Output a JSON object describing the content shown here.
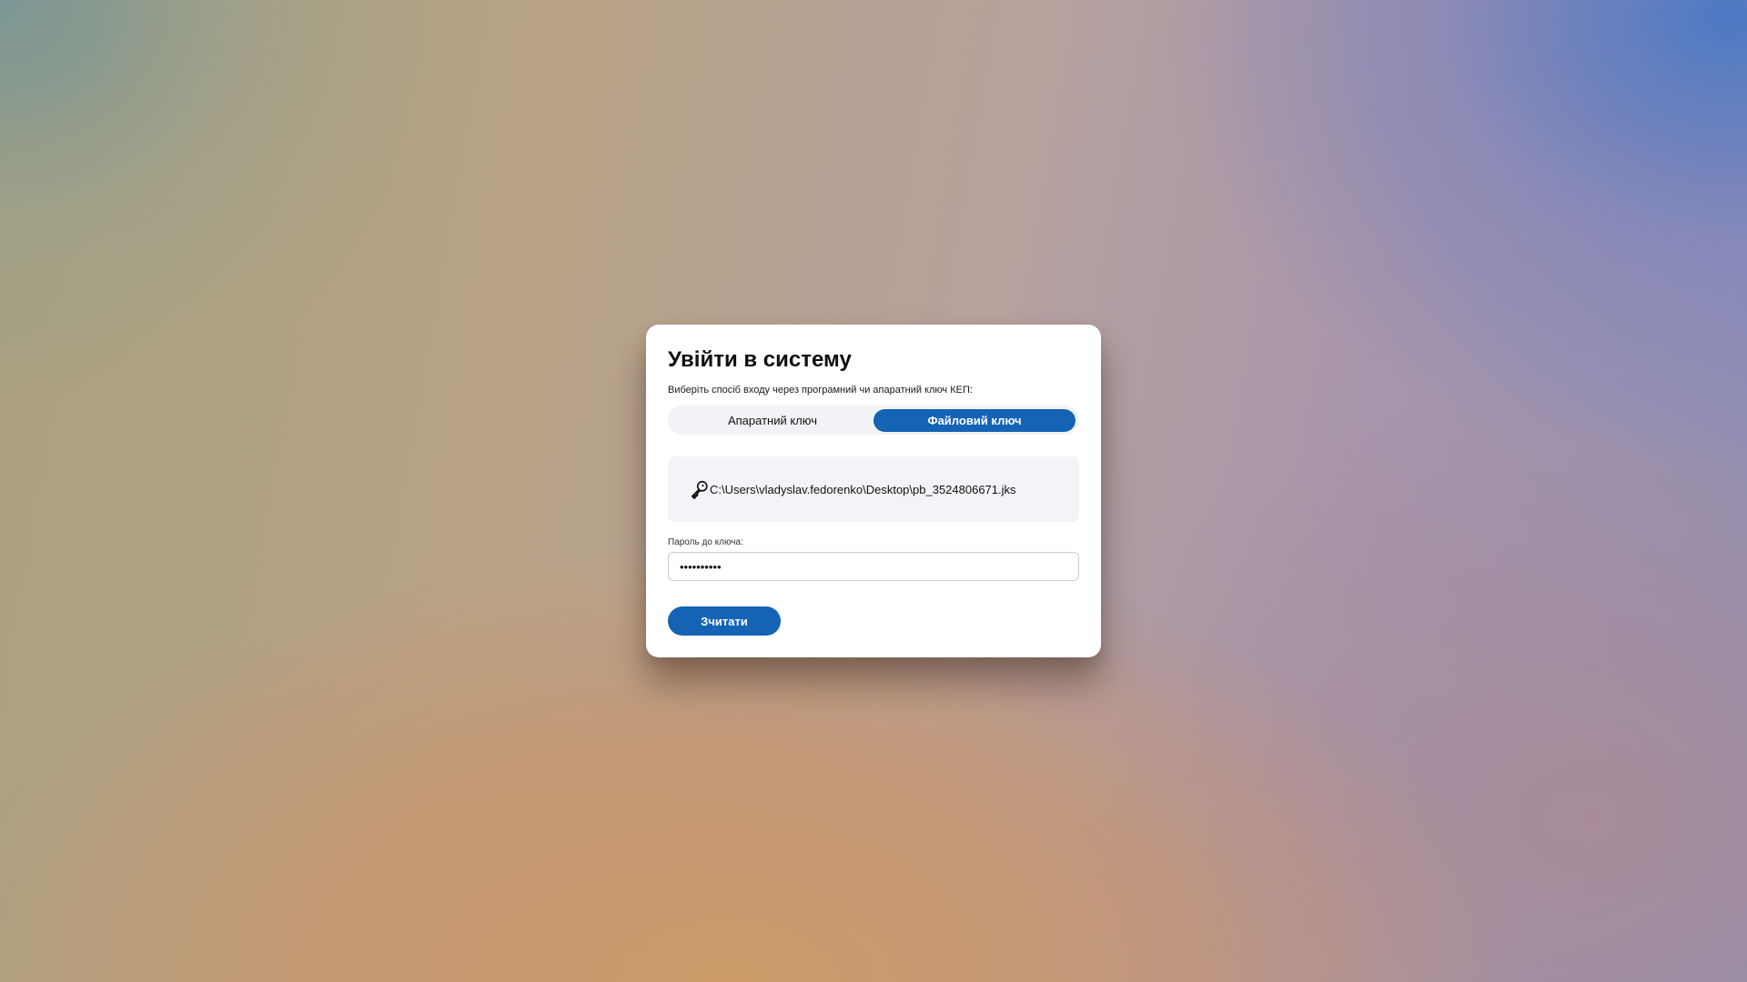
{
  "dialog": {
    "title": "Увійти в систему",
    "subtitle": "Виберіть спосіб входу через програмний чи апаратний ключ КЕП:"
  },
  "key_type_toggle": {
    "options": [
      {
        "label": "Апаратний ключ",
        "selected": false
      },
      {
        "label": "Файловий ключ",
        "selected": true
      }
    ]
  },
  "file_key": {
    "icon": "key-icon",
    "path": "C:\\Users\\vladyslav.fedorenko\\Desktop\\pb_3524806671.jks"
  },
  "password": {
    "label": "Пароль до ключа:",
    "value": "••••••••••"
  },
  "actions": {
    "read_label": "Зчитати"
  },
  "colors": {
    "accent": "#1463b5",
    "panel_bg": "#f3f4f7",
    "dialog_bg": "#ffffff"
  }
}
